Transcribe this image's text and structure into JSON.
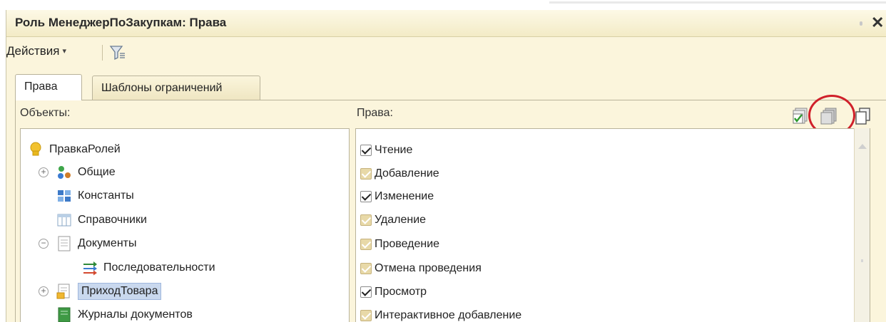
{
  "window": {
    "title": "Роль МенеджерПоЗакупкам: Права",
    "close": "✕"
  },
  "toolbar": {
    "actions_label": "Действия",
    "actions_caret": "▾"
  },
  "tabs": [
    {
      "label": "Права",
      "active": true
    },
    {
      "label": "Шаблоны ограничений",
      "active": false
    }
  ],
  "objects_panel": {
    "label": "Объекты:",
    "items": [
      {
        "label": "ПравкаРолей",
        "icon": "key-icon",
        "expander": ""
      },
      {
        "label": "Общие",
        "icon": "common-objects-icon",
        "expander": "+"
      },
      {
        "label": "Константы",
        "icon": "constants-icon",
        "expander": ""
      },
      {
        "label": "Справочники",
        "icon": "catalogs-icon",
        "expander": ""
      },
      {
        "label": "Документы",
        "icon": "documents-icon",
        "expander": "−"
      },
      {
        "label": "Последовательности",
        "icon": "sequences-icon",
        "expander": ""
      },
      {
        "label": "ПриходТовара",
        "icon": "document-item-icon",
        "expander": "+",
        "selected": true
      },
      {
        "label": "Журналы документов",
        "icon": "journals-icon",
        "expander": ""
      }
    ]
  },
  "rights_panel": {
    "label": "Права:",
    "items": [
      {
        "label": "Чтение",
        "state": "checked"
      },
      {
        "label": "Добавление",
        "state": "partial"
      },
      {
        "label": "Изменение",
        "state": "checked"
      },
      {
        "label": "Удаление",
        "state": "partial"
      },
      {
        "label": "Проведение",
        "state": "partial"
      },
      {
        "label": "Отмена проведения",
        "state": "partial"
      },
      {
        "label": "Просмотр",
        "state": "checked"
      },
      {
        "label": "Интерактивное добавление",
        "state": "partial"
      }
    ]
  },
  "colors": {
    "highlight_circle": "#d0202a",
    "selection": "#c9d8ee",
    "panel_bg": "#fbf5dc"
  }
}
